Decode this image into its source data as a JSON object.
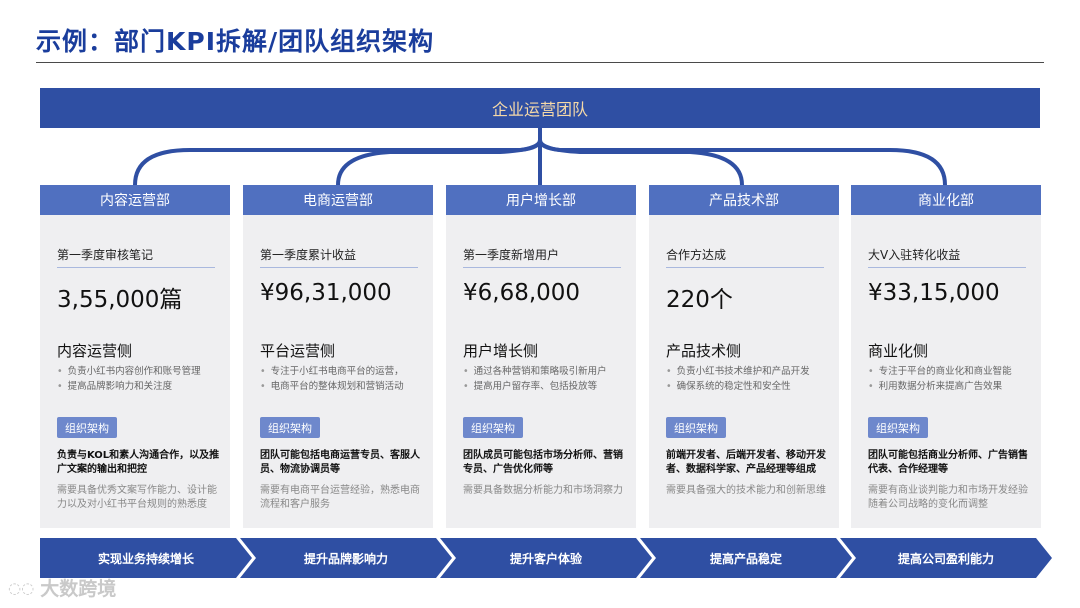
{
  "title": "示例：部门KPI拆解/团队组织架构",
  "top_label": "企业运营团队",
  "departments": [
    {
      "name": "内容运营部",
      "metric_label": "第一季度审核笔记",
      "metric_value": "3,55,000篇",
      "side_title": "内容运营侧",
      "bullets": [
        "负责小红书内容创作和账号管理",
        "提高品牌影响力和关注度"
      ],
      "tag": "组织架构",
      "desc": "负责与KOL和素人沟通合作，以及推广文案的输出和把控",
      "note": "需要具备优秀文案写作能力、设计能力以及对小红书平台规则的熟悉度"
    },
    {
      "name": "电商运营部",
      "metric_label": "第一季度累计收益",
      "metric_value": "¥96,31,000",
      "side_title": "平台运营侧",
      "bullets": [
        "专注于小红书电商平台的运营，",
        "电商平台的整体规划和营销活动"
      ],
      "tag": "组织架构",
      "desc": "团队可能包括电商运营专员、客服人员、物流协调员等",
      "note": "需要有电商平台运营经验，熟悉电商流程和客户服务"
    },
    {
      "name": "用户增长部",
      "metric_label": "第一季度新增用户",
      "metric_value": "¥6,68,000",
      "side_title": "用户增长侧",
      "bullets": [
        "通过各种营销和策略吸引新用户",
        "提高用户留存率、包括投放等"
      ],
      "tag": "组织架构",
      "desc": "团队成员可能包括市场分析师、营销专员、广告优化师等",
      "note": "需要具备数据分析能力和市场洞察力"
    },
    {
      "name": "产品技术部",
      "metric_label": "合作方达成",
      "metric_value": "220个",
      "side_title": "产品技术侧",
      "bullets": [
        "负责小红书技术维护和产品开发",
        "确保系统的稳定性和安全性"
      ],
      "tag": "组织架构",
      "desc": "前端开发者、后端开发者、移动开发者、数据科学家、产品经理等组成",
      "note": "需要具备强大的技术能力和创新思维"
    },
    {
      "name": "商业化部",
      "metric_label": "大V入驻转化收益",
      "metric_value": "¥33,15,000",
      "side_title": "商业化侧",
      "bullets": [
        "专注于平台的商业化和商业智能",
        "利用数据分析来提高广告效果"
      ],
      "tag": "组织架构",
      "desc": "团队可能包括商业分析师、广告销售代表、合作经理等",
      "note": "需要有商业谈判能力和市场开发经验随着公司战略的变化而调整"
    }
  ],
  "goals": [
    "实现业务持续增长",
    "提升品牌影响力",
    "提升客户体验",
    "提高产品稳定",
    "提高公司盈利能力"
  ],
  "watermark": "大数跨境",
  "colors": {
    "primary": "#2f4fa3",
    "card_header": "#5070c0",
    "tag": "#6e88cc",
    "card_bg": "#efeff1",
    "title": "#1a3d9c",
    "top_text": "#f5d9a8"
  }
}
